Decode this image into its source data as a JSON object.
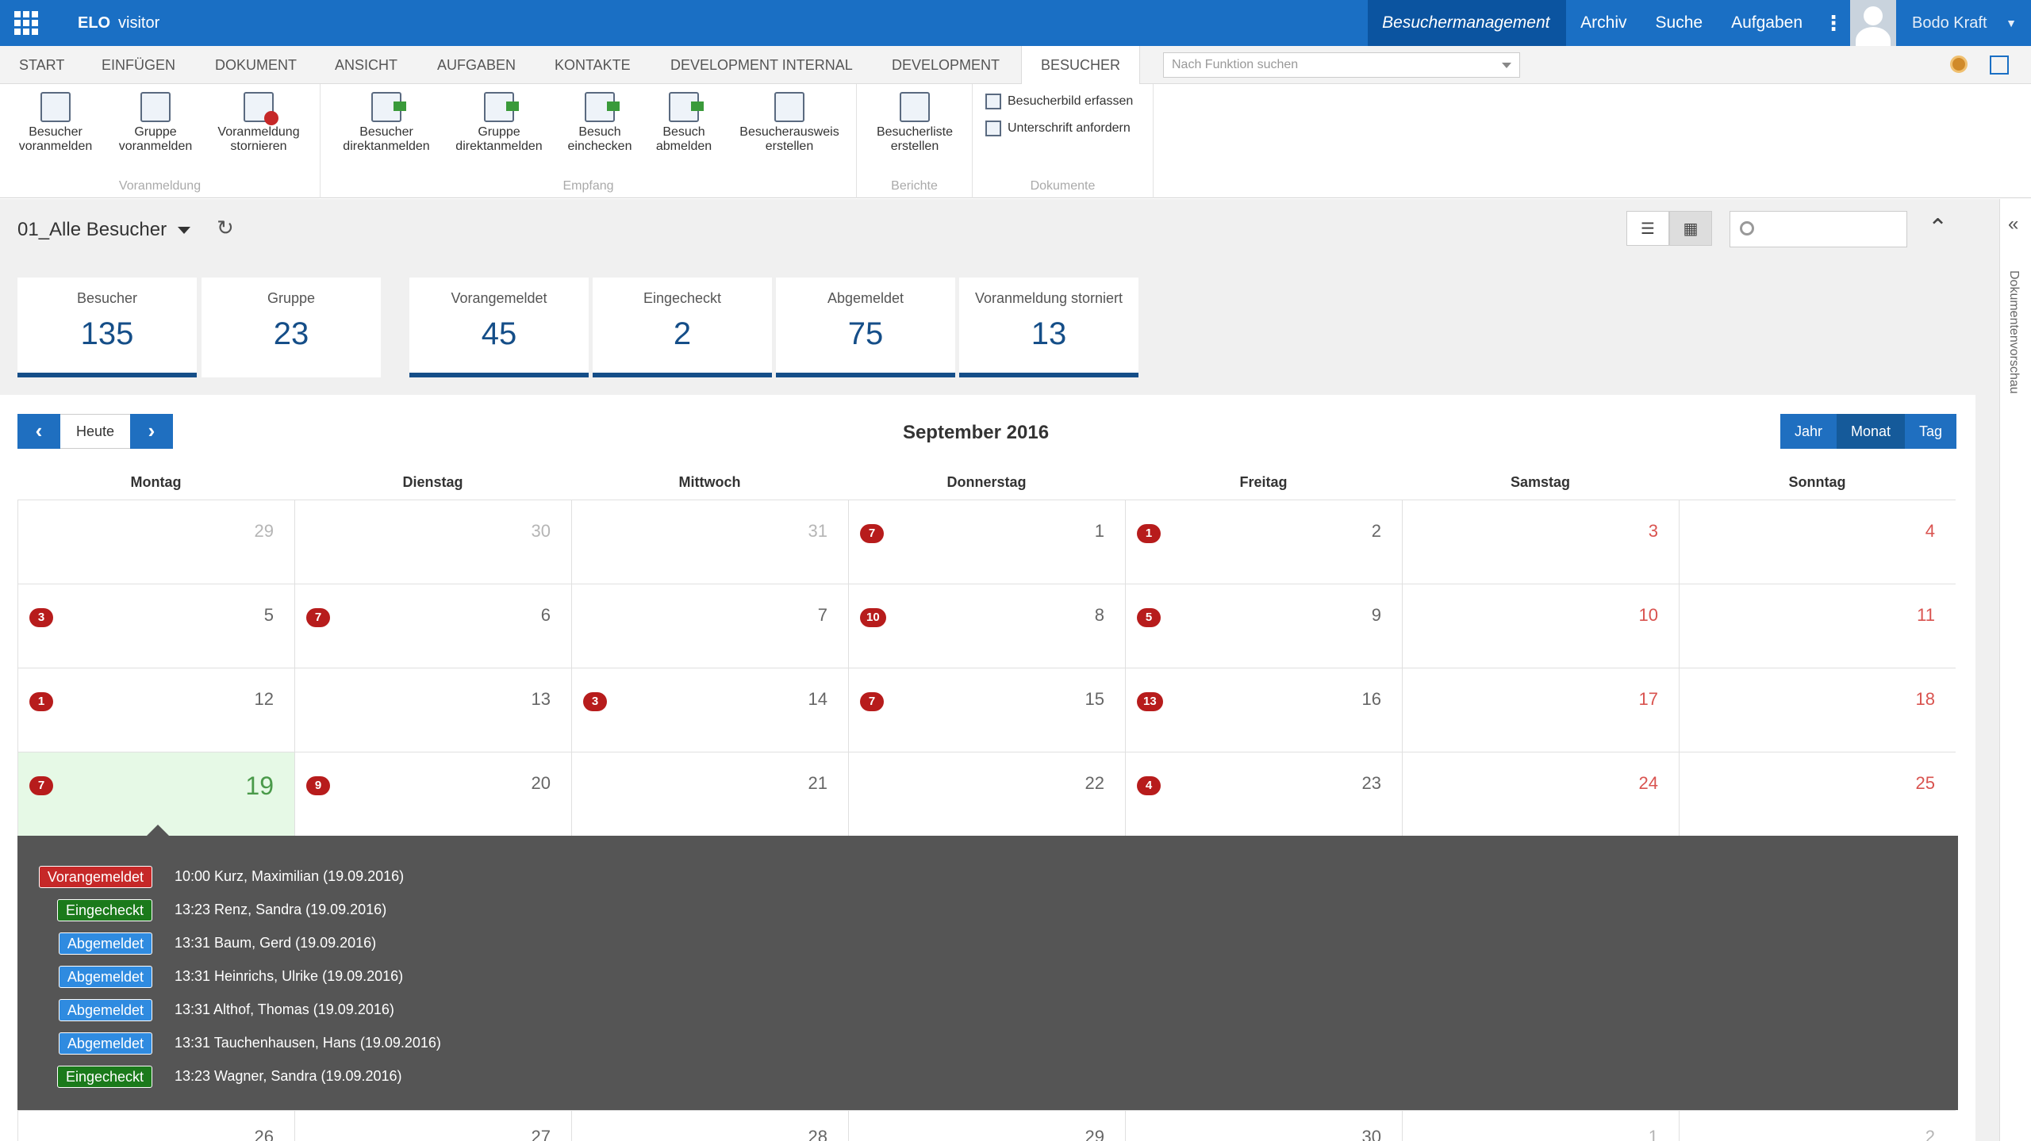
{
  "app": {
    "brand": "ELO",
    "brand_suffix": "visitor"
  },
  "topnav": {
    "items": [
      "Besuchermanagement",
      "Archiv",
      "Suche",
      "Aufgaben"
    ],
    "user": "Bodo Kraft"
  },
  "tabs": [
    "START",
    "EINFÜGEN",
    "DOKUMENT",
    "ANSICHT",
    "AUFGABEN",
    "KONTAKTE",
    "DEVELOPMENT INTERNAL",
    "DEVELOPMENT",
    "BESUCHER"
  ],
  "function_search": {
    "placeholder": "Nach Funktion suchen"
  },
  "ribbon": {
    "groups": {
      "voranmeldung": "Voranmeldung",
      "empfang": "Empfang",
      "berichte": "Berichte",
      "dokumente": "Dokumente"
    },
    "buttons": {
      "b1": [
        "Besucher",
        "voranmelden"
      ],
      "b2": [
        "Gruppe",
        "voranmelden"
      ],
      "b3": [
        "Voranmeldung",
        "stornieren"
      ],
      "b4": [
        "Besucher",
        "direktanmelden"
      ],
      "b5": [
        "Gruppe",
        "direktanmelden"
      ],
      "b6": [
        "Besuch",
        "einchecken"
      ],
      "b7": [
        "Besuch",
        "abmelden"
      ],
      "b8": [
        "Besucherausweis",
        "erstellen"
      ],
      "b9": [
        "Besucherliste",
        "erstellen"
      ]
    },
    "small": {
      "s1": "Besucherbild erfassen",
      "s2": "Unterschrift anfordern"
    }
  },
  "sidebar": {
    "label": "Dokumentenvorschau"
  },
  "view": {
    "name": "01_Alle Besucher"
  },
  "stats": [
    {
      "label": "Besucher",
      "value": "135"
    },
    {
      "label": "Gruppe",
      "value": "23"
    },
    {
      "label": "Vorangemeldet",
      "value": "45"
    },
    {
      "label": "Eingecheckt",
      "value": "2"
    },
    {
      "label": "Abgemeldet",
      "value": "75"
    },
    {
      "label": "Voranmeldung storniert",
      "value": "13"
    }
  ],
  "calendar": {
    "today_label": "Heute",
    "month": "September 2016",
    "scales": [
      "Jahr",
      "Monat",
      "Tag"
    ],
    "days": [
      "Montag",
      "Dienstag",
      "Mittwoch",
      "Donnerstag",
      "Freitag",
      "Samstag",
      "Sonntag"
    ],
    "weeks": [
      [
        {
          "d": "29",
          "b": ""
        },
        {
          "d": "30",
          "b": ""
        },
        {
          "d": "31",
          "b": ""
        },
        {
          "d": "1",
          "b": "7"
        },
        {
          "d": "2",
          "b": "1"
        },
        {
          "d": "3",
          "b": ""
        },
        {
          "d": "4",
          "b": ""
        }
      ],
      [
        {
          "d": "5",
          "b": "3"
        },
        {
          "d": "6",
          "b": "7"
        },
        {
          "d": "7",
          "b": ""
        },
        {
          "d": "8",
          "b": "10"
        },
        {
          "d": "9",
          "b": "5"
        },
        {
          "d": "10",
          "b": ""
        },
        {
          "d": "11",
          "b": ""
        }
      ],
      [
        {
          "d": "12",
          "b": "1"
        },
        {
          "d": "13",
          "b": ""
        },
        {
          "d": "14",
          "b": "3"
        },
        {
          "d": "15",
          "b": "7"
        },
        {
          "d": "16",
          "b": "13"
        },
        {
          "d": "17",
          "b": ""
        },
        {
          "d": "18",
          "b": ""
        }
      ],
      [
        {
          "d": "19",
          "b": "7"
        },
        {
          "d": "20",
          "b": "9"
        },
        {
          "d": "21",
          "b": ""
        },
        {
          "d": "22",
          "b": ""
        },
        {
          "d": "23",
          "b": "4"
        },
        {
          "d": "24",
          "b": ""
        },
        {
          "d": "25",
          "b": ""
        }
      ],
      [
        {
          "d": "26",
          "b": ""
        },
        {
          "d": "27",
          "b": ""
        },
        {
          "d": "28",
          "b": ""
        },
        {
          "d": "29",
          "b": ""
        },
        {
          "d": "30",
          "b": ""
        },
        {
          "d": "1",
          "b": ""
        },
        {
          "d": "2",
          "b": ""
        }
      ]
    ],
    "entries": [
      {
        "status": "Vorangemeldet",
        "text": "10:00 Kurz, Maximilian (19.09.2016)",
        "color": "red"
      },
      {
        "status": "Eingecheckt",
        "text": "13:23 Renz, Sandra (19.09.2016)",
        "color": "green"
      },
      {
        "status": "Abgemeldet",
        "text": "13:31 Baum, Gerd (19.09.2016)",
        "color": "blue"
      },
      {
        "status": "Abgemeldet",
        "text": "13:31 Heinrichs, Ulrike (19.09.2016)",
        "color": "blue"
      },
      {
        "status": "Abgemeldet",
        "text": "13:31 Althof, Thomas (19.09.2016)",
        "color": "blue"
      },
      {
        "status": "Abgemeldet",
        "text": "13:31 Tauchenhausen, Hans (19.09.2016)",
        "color": "blue"
      },
      {
        "status": "Eingecheckt",
        "text": "13:23 Wagner, Sandra (19.09.2016)",
        "color": "green"
      }
    ]
  },
  "colors": {
    "brand": "#1a6fc4",
    "active": "#0b54a0",
    "accent": "#154e88",
    "badge": "#b71c1c"
  }
}
